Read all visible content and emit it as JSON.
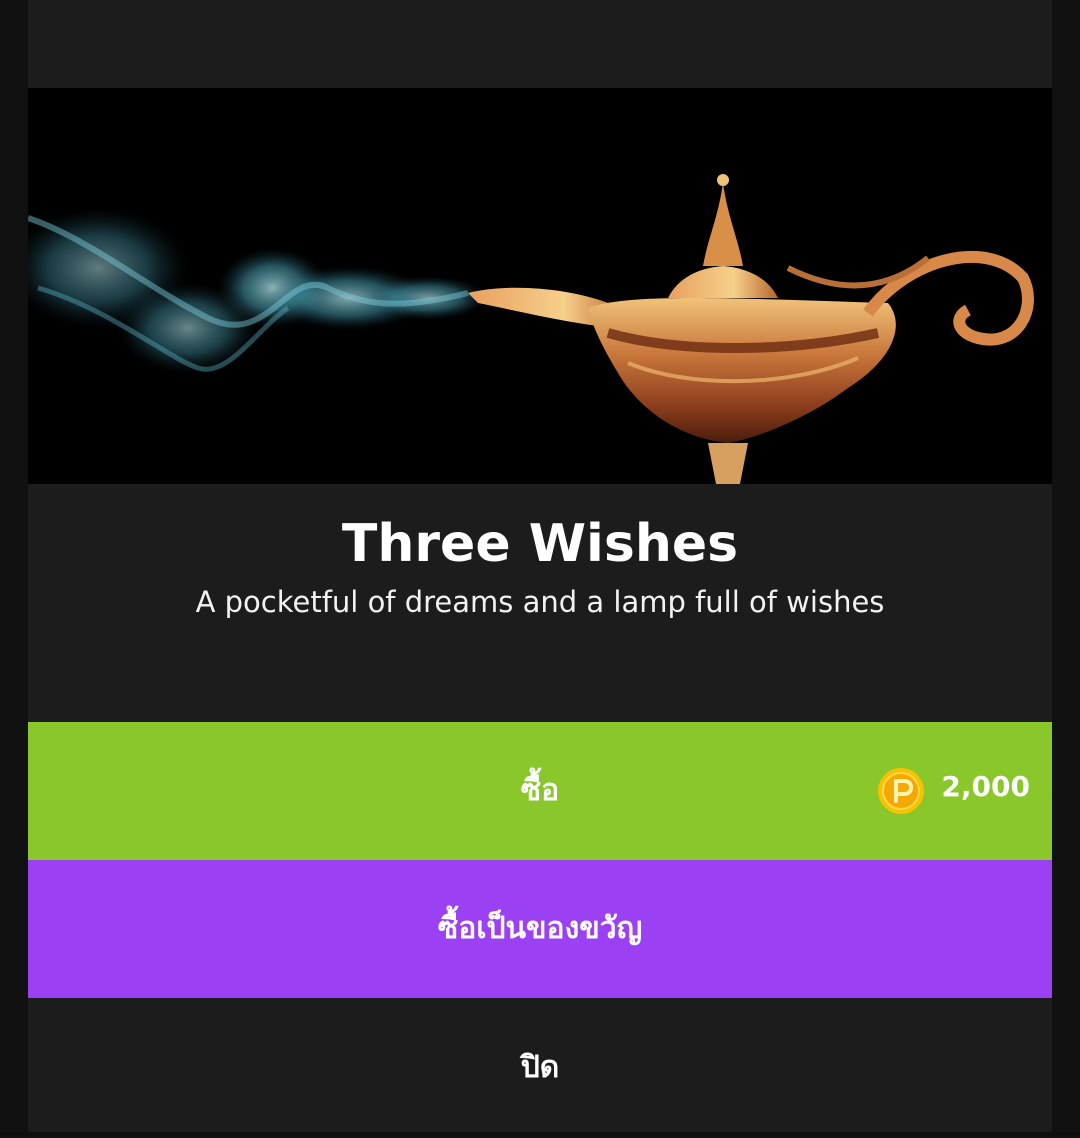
{
  "product": {
    "title": "Three Wishes",
    "subtitle": "A pocketful of dreams and a lamp full of wishes",
    "banner_image": "magic-lamp-with-smoke"
  },
  "actions": {
    "buy_label": "ซื้อ",
    "price": "2,000",
    "currency_icon": "coin-p-icon",
    "gift_label": "ซื้อเป็นของขวัญ",
    "close_label": "ปิด"
  },
  "colors": {
    "buy_button": "#89c72b",
    "gift_button": "#9b40f2",
    "sheet_background": "#1c1c1c",
    "coin": "#f5b800"
  }
}
